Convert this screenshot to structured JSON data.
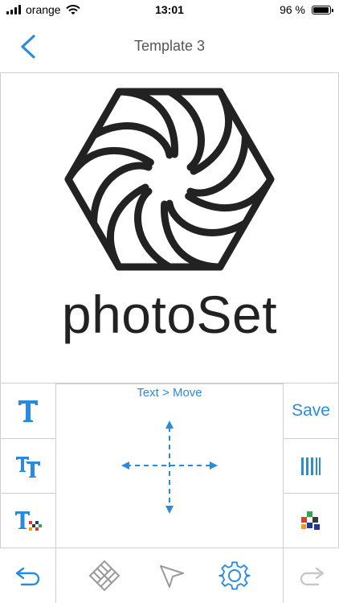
{
  "status_bar": {
    "carrier": "orange",
    "time": "13:01",
    "battery_percent": "96 %",
    "battery_level": 0.96
  },
  "nav": {
    "title": "Template 3",
    "back_icon": "chevron-left-icon"
  },
  "canvas": {
    "logo_icon": "aperture-hexagon-icon",
    "brand_text": "photoSet"
  },
  "editor": {
    "mode_label": "Text > Move",
    "save_label": "Save",
    "left_tools": [
      "text-icon",
      "text-size-icon",
      "text-color-icon"
    ],
    "right_tools": [
      "barcode-icon",
      "color-palette-icon"
    ],
    "move_icon": "move-arrows-icon"
  },
  "toolbar": {
    "items": [
      "undo-icon",
      "grid-pattern-icon",
      "select-pointer-icon",
      "settings-gear-icon",
      "redo-icon"
    ]
  },
  "colors": {
    "accent": "#2a8bdc",
    "border": "#cfcfcf",
    "disabled": "#c8c8c8"
  }
}
